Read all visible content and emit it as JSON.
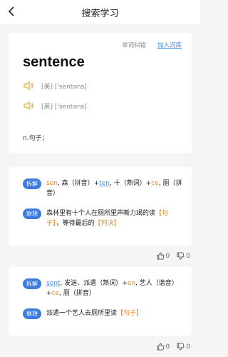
{
  "header": {
    "title": "搜索学习"
  },
  "word_card": {
    "link_report": "单词纠错",
    "link_add": "加入词库",
    "word": "sentence",
    "pron_us": "[美] ['sentəns]",
    "pron_uk": "[英] ['sentəns]",
    "meaning": "n.句子；"
  },
  "card1": {
    "tag1": "拆解",
    "p1": "sen",
    "p2": ", 森（拼音）+",
    "p3": "ten",
    "p4": ", 十（熟词）+",
    "p5": "ce",
    "p6": ", 厕（拼音）",
    "tag2": "联想",
    "a1": "森林里有十个人在厕所里声嘶力竭的读",
    "a2": "【句子】",
    "a3": "，等待最后的",
    "a4": "【判决】"
  },
  "votes1": {
    "up": "0",
    "down": "0"
  },
  "card2": {
    "tag1": "拆解",
    "p1": "sent",
    "p2": ", 发送、派遣（熟词）+",
    "p3": "en",
    "p4": ", 艺人（谐音）+",
    "p5": "ce",
    "p6": ", 厕（拼音）",
    "tag2": "联想",
    "a1": "派遣一个艺人去厕所里读",
    "a2": "【句子】"
  },
  "votes2": {
    "up": "0",
    "down": "0"
  },
  "colors": {
    "accent": "#3b7be0",
    "highlight": "#e08a2c",
    "link": "#4a90d9"
  }
}
